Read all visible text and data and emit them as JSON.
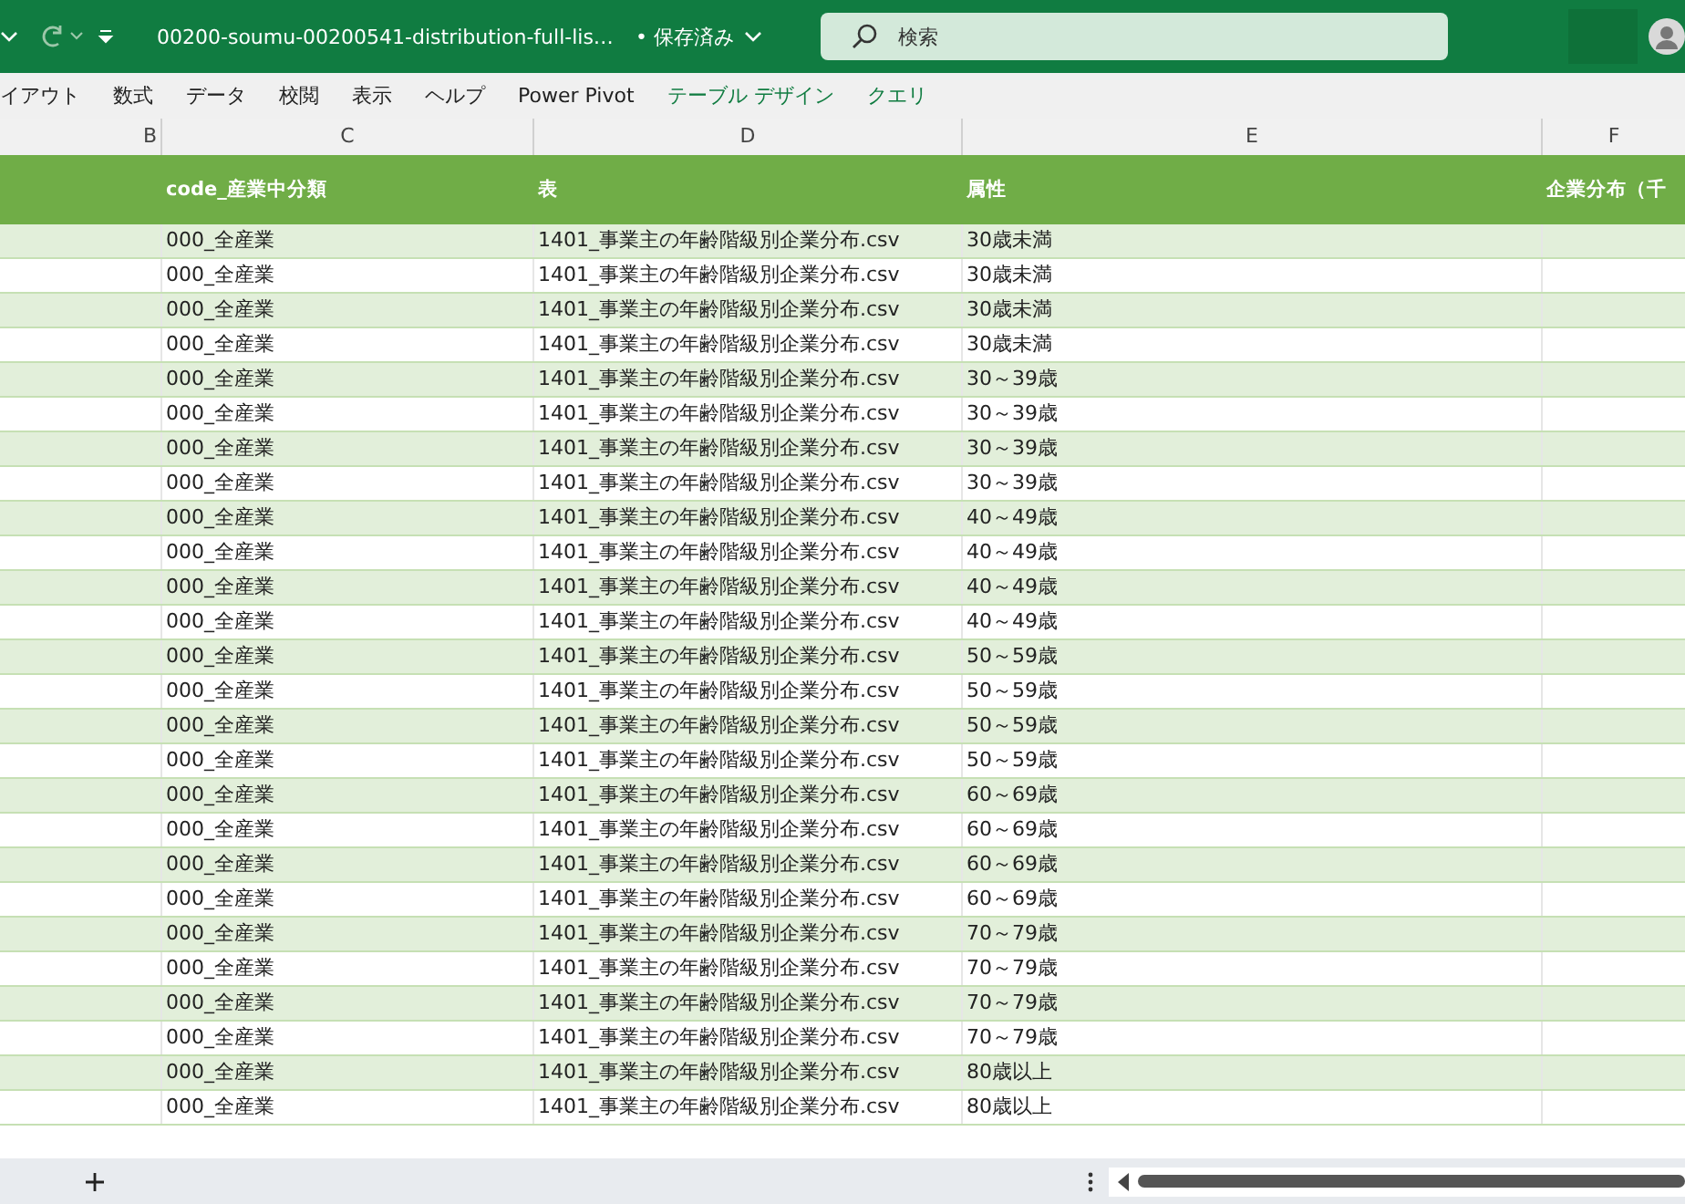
{
  "title_bar": {
    "file_name": "00200-soumu-00200541-distribution-full-lis…",
    "save_status": "• 保存済み",
    "search": {
      "placeholder": "検索"
    }
  },
  "ribbon_tabs": [
    {
      "label": "イアウト",
      "kind": "standard"
    },
    {
      "label": "数式",
      "kind": "standard"
    },
    {
      "label": "データ",
      "kind": "standard"
    },
    {
      "label": "校閲",
      "kind": "standard"
    },
    {
      "label": "表示",
      "kind": "standard"
    },
    {
      "label": "ヘルプ",
      "kind": "standard"
    },
    {
      "label": "Power Pivot",
      "kind": "standard"
    },
    {
      "label": "テーブル デザイン",
      "kind": "contextual"
    },
    {
      "label": "クエリ",
      "kind": "contextual"
    }
  ],
  "column_letters": [
    "B",
    "C",
    "D",
    "E",
    "F"
  ],
  "table": {
    "headers": [
      "code_産業中分類",
      "表",
      "属性",
      "企業分布（千"
    ],
    "rows": [
      {
        "code": "000_全産業",
        "table": "1401_事業主の年齢階級別企業分布.csv",
        "attribute": "30歳未満"
      },
      {
        "code": "000_全産業",
        "table": "1401_事業主の年齢階級別企業分布.csv",
        "attribute": "30歳未満"
      },
      {
        "code": "000_全産業",
        "table": "1401_事業主の年齢階級別企業分布.csv",
        "attribute": "30歳未満"
      },
      {
        "code": "000_全産業",
        "table": "1401_事業主の年齢階級別企業分布.csv",
        "attribute": "30歳未満"
      },
      {
        "code": "000_全産業",
        "table": "1401_事業主の年齢階級別企業分布.csv",
        "attribute": "30～39歳"
      },
      {
        "code": "000_全産業",
        "table": "1401_事業主の年齢階級別企業分布.csv",
        "attribute": "30～39歳"
      },
      {
        "code": "000_全産業",
        "table": "1401_事業主の年齢階級別企業分布.csv",
        "attribute": "30～39歳"
      },
      {
        "code": "000_全産業",
        "table": "1401_事業主の年齢階級別企業分布.csv",
        "attribute": "30～39歳"
      },
      {
        "code": "000_全産業",
        "table": "1401_事業主の年齢階級別企業分布.csv",
        "attribute": "40～49歳"
      },
      {
        "code": "000_全産業",
        "table": "1401_事業主の年齢階級別企業分布.csv",
        "attribute": "40～49歳"
      },
      {
        "code": "000_全産業",
        "table": "1401_事業主の年齢階級別企業分布.csv",
        "attribute": "40～49歳"
      },
      {
        "code": "000_全産業",
        "table": "1401_事業主の年齢階級別企業分布.csv",
        "attribute": "40～49歳"
      },
      {
        "code": "000_全産業",
        "table": "1401_事業主の年齢階級別企業分布.csv",
        "attribute": "50～59歳"
      },
      {
        "code": "000_全産業",
        "table": "1401_事業主の年齢階級別企業分布.csv",
        "attribute": "50～59歳"
      },
      {
        "code": "000_全産業",
        "table": "1401_事業主の年齢階級別企業分布.csv",
        "attribute": "50～59歳"
      },
      {
        "code": "000_全産業",
        "table": "1401_事業主の年齢階級別企業分布.csv",
        "attribute": "50～59歳"
      },
      {
        "code": "000_全産業",
        "table": "1401_事業主の年齢階級別企業分布.csv",
        "attribute": "60～69歳"
      },
      {
        "code": "000_全産業",
        "table": "1401_事業主の年齢階級別企業分布.csv",
        "attribute": "60～69歳"
      },
      {
        "code": "000_全産業",
        "table": "1401_事業主の年齢階級別企業分布.csv",
        "attribute": "60～69歳"
      },
      {
        "code": "000_全産業",
        "table": "1401_事業主の年齢階級別企業分布.csv",
        "attribute": "60～69歳"
      },
      {
        "code": "000_全産業",
        "table": "1401_事業主の年齢階級別企業分布.csv",
        "attribute": "70～79歳"
      },
      {
        "code": "000_全産業",
        "table": "1401_事業主の年齢階級別企業分布.csv",
        "attribute": "70～79歳"
      },
      {
        "code": "000_全産業",
        "table": "1401_事業主の年齢階級別企業分布.csv",
        "attribute": "70～79歳"
      },
      {
        "code": "000_全産業",
        "table": "1401_事業主の年齢階級別企業分布.csv",
        "attribute": "70～79歳"
      },
      {
        "code": "000_全産業",
        "table": "1401_事業主の年齢階級別企業分布.csv",
        "attribute": "80歳以上"
      },
      {
        "code": "000_全産業",
        "table": "1401_事業主の年齢階級別企業分布.csv",
        "attribute": "80歳以上"
      }
    ]
  }
}
